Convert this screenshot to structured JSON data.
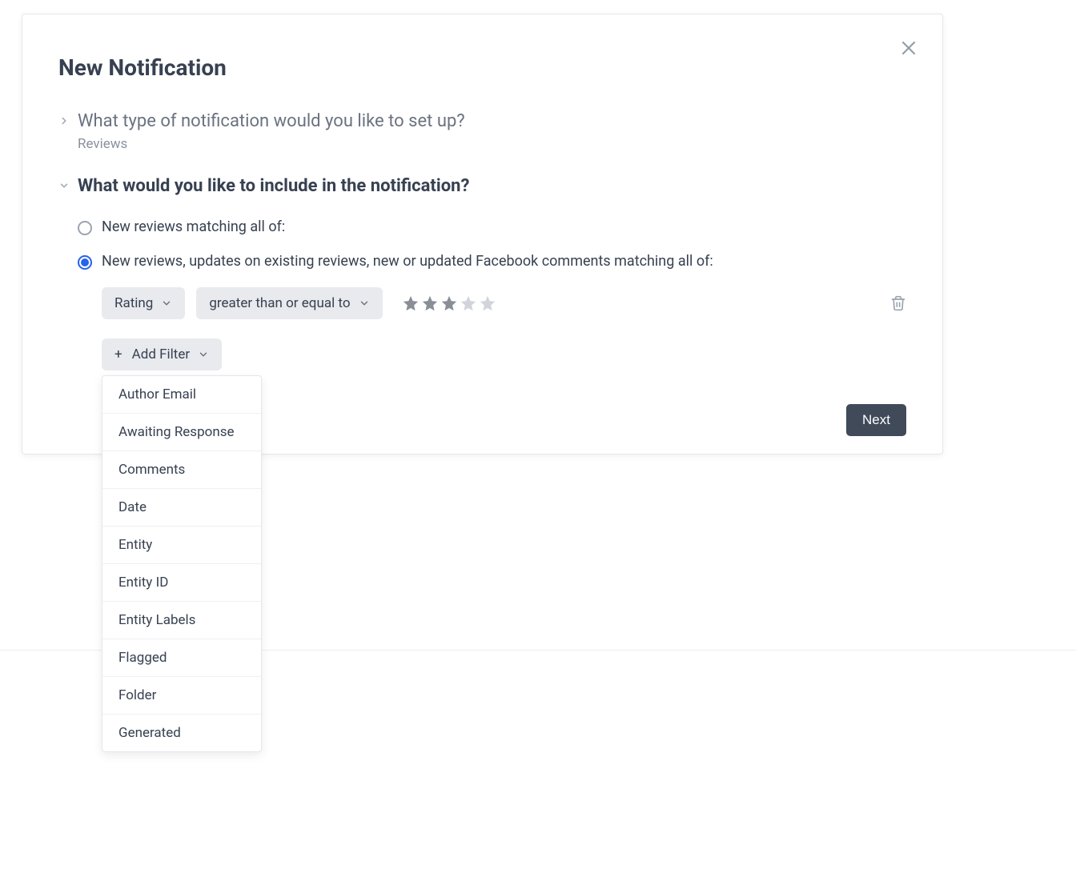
{
  "modal": {
    "title": "New Notification",
    "close_icon": "close-icon"
  },
  "step1": {
    "title": "What type of notification would you like to set up?",
    "value": "Reviews"
  },
  "step2": {
    "title": "What would you like to include in the notification?",
    "options": [
      {
        "label": "New reviews matching all of:",
        "selected": false
      },
      {
        "label": "New reviews, updates on existing reviews, new or updated Facebook comments matching all of:",
        "selected": true
      }
    ]
  },
  "filter": {
    "field": "Rating",
    "operator": "greater than or equal to",
    "star_value": 3,
    "star_max": 5
  },
  "add_filter": {
    "label": "Add Filter",
    "options": [
      "Author Email",
      "Awaiting Response",
      "Comments",
      "Date",
      "Entity",
      "Entity ID",
      "Entity Labels",
      "Flagged",
      "Folder",
      "Generated"
    ]
  },
  "footer": {
    "next_label": "Next"
  }
}
